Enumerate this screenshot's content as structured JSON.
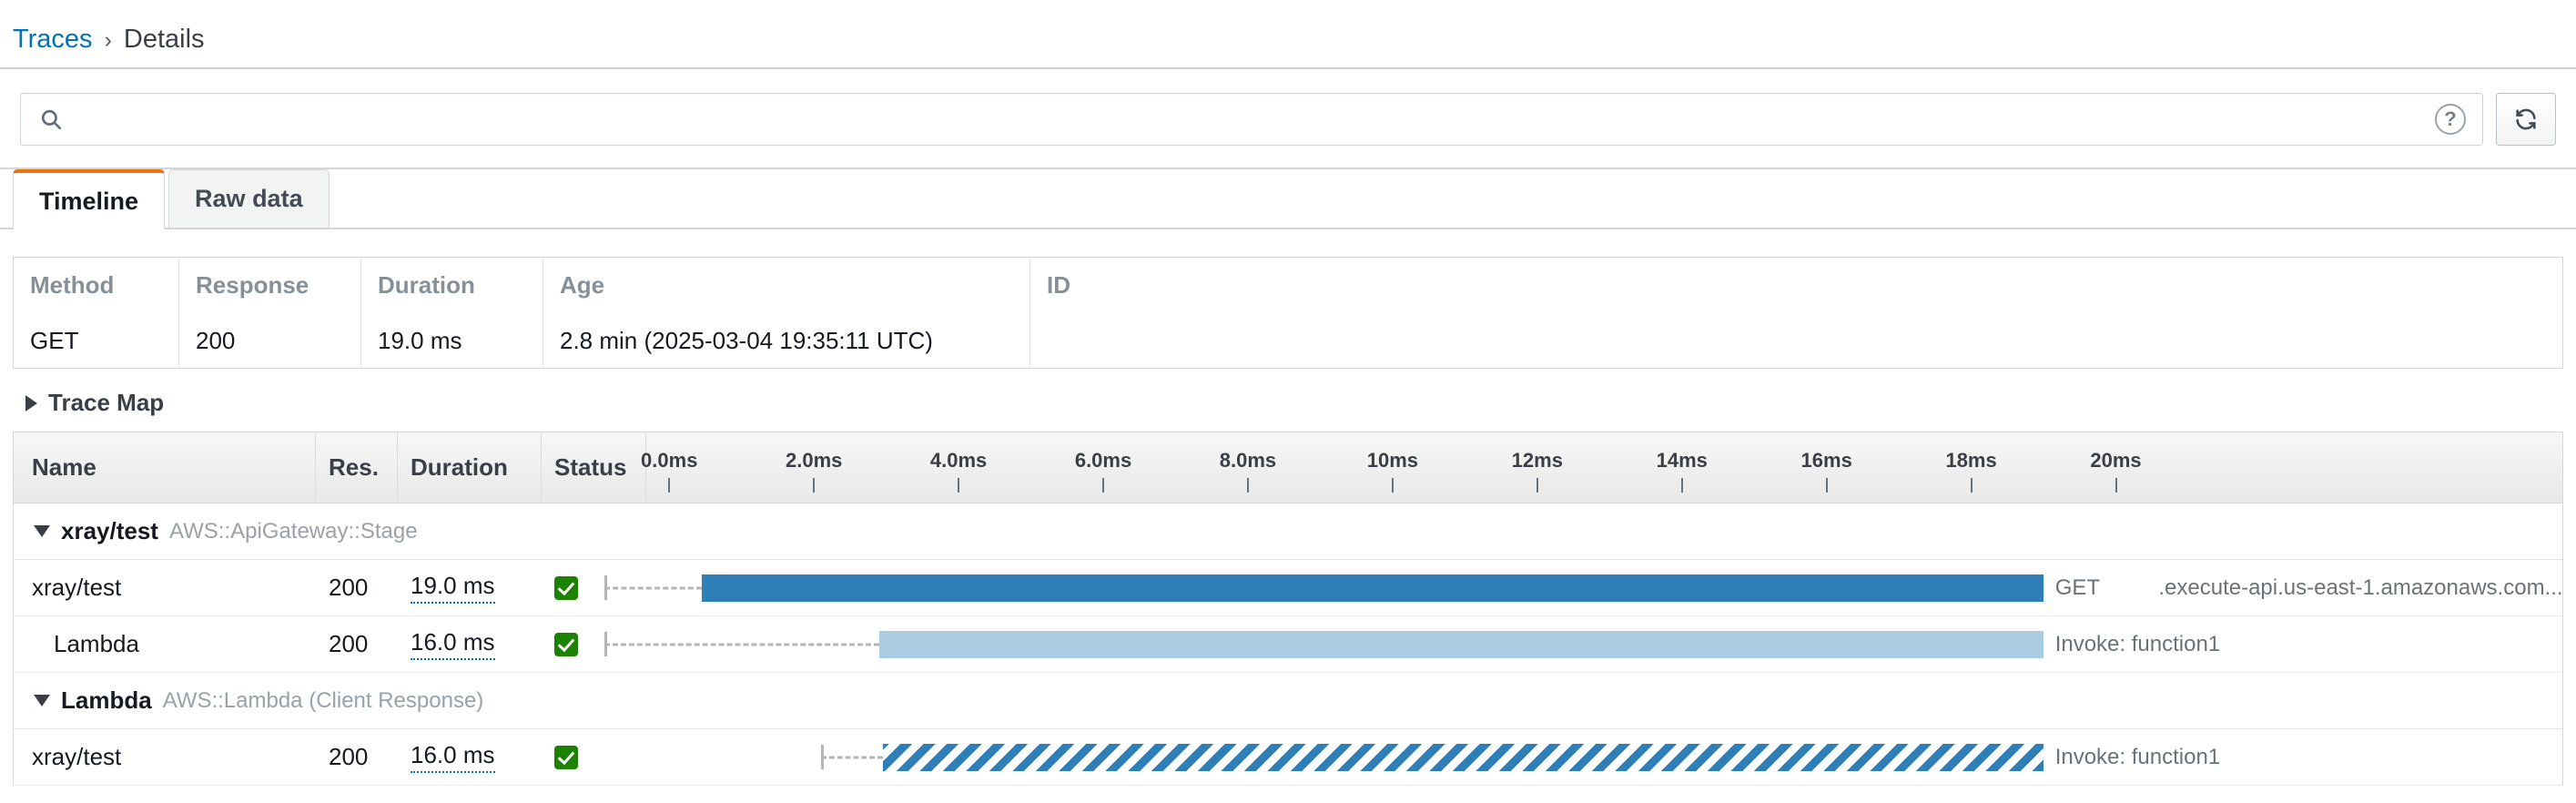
{
  "breadcrumb": {
    "root": "Traces",
    "separator": "›",
    "current": "Details"
  },
  "search": {
    "value": "",
    "placeholder": "",
    "icon": "search-icon",
    "help_icon": "help-circle-icon",
    "help_label": "?",
    "refresh_icon": "refresh-icon"
  },
  "tabs": [
    {
      "label": "Timeline",
      "active": true
    },
    {
      "label": "Raw data",
      "active": false
    }
  ],
  "meta": {
    "headers": [
      "Method",
      "Response",
      "Duration",
      "Age",
      "ID"
    ],
    "row": {
      "method": "GET",
      "response": "200",
      "duration": "19.0 ms",
      "age": "2.8 min (2025-03-04 19:35:11 UTC)",
      "id": ""
    }
  },
  "trace_map": {
    "label": "Trace Map",
    "expanded": false,
    "toggle_icon": "triangle-right-icon"
  },
  "segments": {
    "headers": [
      "Name",
      "Res.",
      "Duration",
      "Status"
    ],
    "axis": {
      "ticks": [
        "0.0ms",
        "2.0ms",
        "4.0ms",
        "6.0ms",
        "8.0ms",
        "10ms",
        "12ms",
        "14ms",
        "16ms",
        "18ms",
        "20ms"
      ],
      "min_ms": 0,
      "max_ms": 20
    },
    "groups": [
      {
        "name": "xray/test",
        "type": "AWS::ApiGateway::Stage",
        "expanded": true,
        "toggle_icon": "triangle-down-icon",
        "rows": [
          {
            "name": "xray/test",
            "indent": 0,
            "res": "200",
            "duration": "19.0 ms",
            "status": "ok",
            "bar_style": "solid",
            "bar_start_ms": 0.45,
            "bar_end_ms": 19.0,
            "lead_start_ms": -0.9,
            "bar_label": "GET",
            "bar_url": ".execute-api.us-east-1.amazonaws.com..."
          },
          {
            "name": "Lambda",
            "indent": 1,
            "res": "200",
            "duration": "16.0 ms",
            "status": "ok",
            "bar_style": "light",
            "bar_start_ms": 2.9,
            "bar_end_ms": 19.0,
            "lead_start_ms": -0.9,
            "bar_label": "Invoke: function1",
            "bar_url": ""
          }
        ]
      },
      {
        "name": "Lambda",
        "type": "AWS::Lambda (Client Response)",
        "expanded": true,
        "toggle_icon": "triangle-down-icon",
        "rows": [
          {
            "name": "xray/test",
            "indent": 0,
            "res": "200",
            "duration": "16.0 ms",
            "status": "ok",
            "bar_style": "striped",
            "bar_start_ms": 2.95,
            "bar_end_ms": 19.0,
            "lead_start_ms": 2.1,
            "bar_label": "Invoke: function1",
            "bar_url": ""
          }
        ]
      }
    ]
  },
  "colors": {
    "accent": "#ec7211",
    "link": "#0073bb",
    "bar_solid": "#2e7eb8",
    "bar_light": "#a9cce3",
    "status_ok": "#1d8102"
  }
}
